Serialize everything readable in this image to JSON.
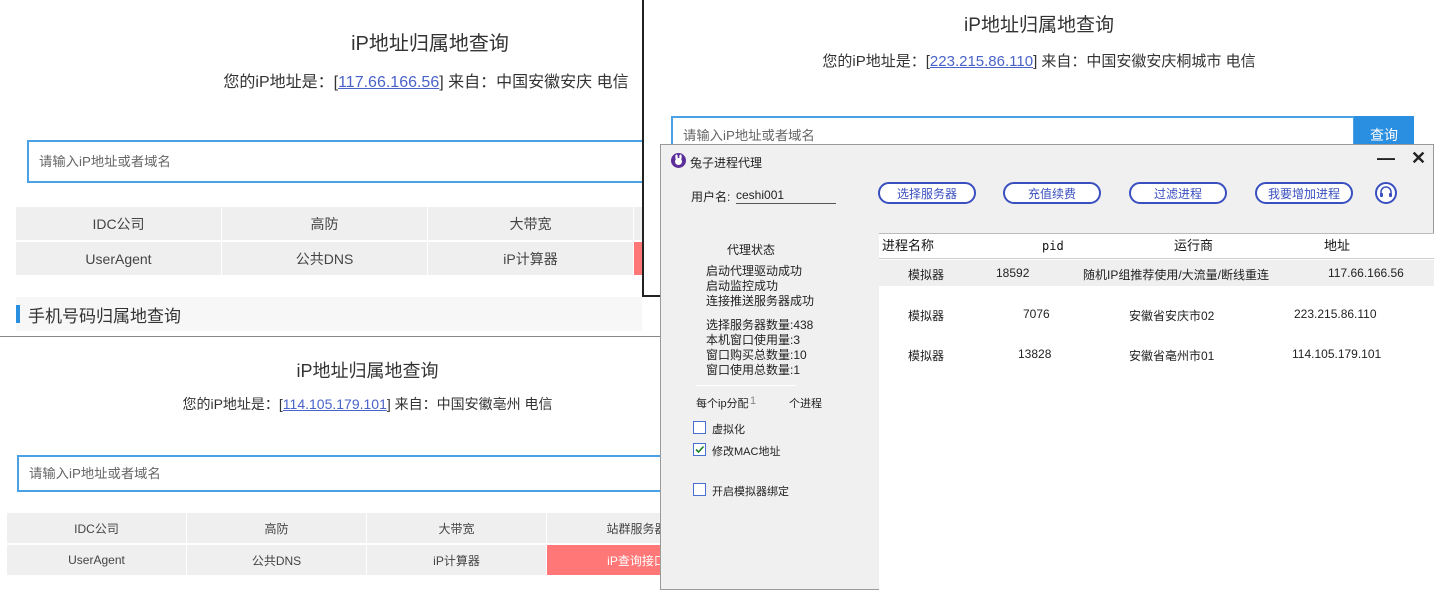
{
  "w1": {
    "title": "iP地址归属地查询",
    "ip_prefix": "您的iP地址是：[",
    "ip": "117.66.166.56",
    "ip_suffix": "] 来自：中国安徽安庆 电信",
    "search_placeholder": "请输入iP地址或者域名",
    "grid": [
      "IDC公司",
      "高防",
      "大带宽",
      "UserAgent",
      "公共DNS",
      "iP计算器"
    ],
    "section_title": "手机号码归属地查询"
  },
  "w2": {
    "title": "iP地址归属地查询",
    "ip_prefix": "您的iP地址是：[",
    "ip": "223.215.86.110",
    "ip_suffix": "] 来自：中国安徽安庆桐城市 电信",
    "search_placeholder": "请输入iP地址或者域名",
    "query_button": "查询"
  },
  "w3": {
    "title": "iP地址归属地查询",
    "ip_prefix": "您的iP地址是：[",
    "ip": "114.105.179.101",
    "ip_suffix": "] 来自：中国安徽亳州 电信",
    "search_placeholder": "请输入iP地址或者域名",
    "grid": [
      "IDC公司",
      "高防",
      "大带宽",
      "站群服务器",
      "UserAgent",
      "公共DNS",
      "iP计算器",
      "iP查询接口"
    ]
  },
  "app": {
    "title": "兔子进程代理",
    "minimize": "—",
    "close": "✕",
    "username_label": "用户名:",
    "username": "ceshi001",
    "buttons": [
      "选择服务器",
      "充值续费",
      "过滤进程",
      "我要增加进程"
    ],
    "status_heading": "代理状态",
    "status_lines": [
      "启动代理驱动成功",
      "启动监控成功",
      "连接推送服务器成功"
    ],
    "stats": [
      "选择服务器数量:438",
      "本机窗口使用量:3",
      "窗口购买总数量:10",
      "窗口使用总数量:1"
    ],
    "per_ip_label": "每个ip分配",
    "per_ip_value": "1",
    "per_ip_unit": "个进程",
    "checkboxes": [
      {
        "label": "虚拟化",
        "checked": false
      },
      {
        "label": "修改MAC地址",
        "checked": true
      },
      {
        "label": "开启模拟器绑定",
        "checked": false
      }
    ],
    "table": {
      "headers": [
        "进程名称",
        "pid",
        "运行商",
        "地址"
      ],
      "rows": [
        [
          "模拟器",
          "18592",
          "随机IP组推荐使用/大流量/断线重连",
          "117.66.166.56"
        ],
        [
          "模拟器",
          "7076",
          "安徽省安庆市02",
          "223.215.86.110"
        ],
        [
          "模拟器",
          "13828",
          "安徽省亳州市01",
          "114.105.179.101"
        ]
      ]
    }
  }
}
